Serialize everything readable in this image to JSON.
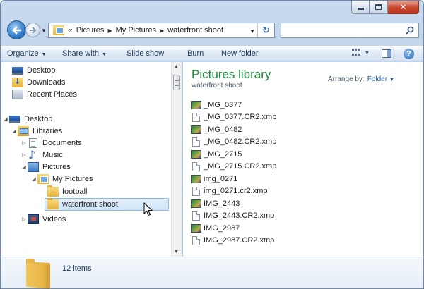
{
  "address": {
    "overflow": "«",
    "crumbs": [
      "Pictures",
      "My Pictures",
      "waterfront shoot"
    ]
  },
  "search": {
    "placeholder": ""
  },
  "toolbar": {
    "organize": "Organize",
    "share_with": "Share with",
    "slide_show": "Slide show",
    "burn": "Burn",
    "new_folder": "New folder"
  },
  "nav_tree": {
    "desktop_fav": "Desktop",
    "downloads": "Downloads",
    "recent_places": "Recent Places",
    "desktop": "Desktop",
    "libraries": "Libraries",
    "documents": "Documents",
    "music": "Music",
    "pictures": "Pictures",
    "my_pictures": "My Pictures",
    "football": "football",
    "waterfront": "waterfront shoot",
    "videos": "Videos"
  },
  "library": {
    "title": "Pictures library",
    "subtitle": "waterfront shoot",
    "arrange_label": "Arrange by:",
    "arrange_value": "Folder"
  },
  "files": [
    {
      "name": "_MG_0377",
      "kind": "image"
    },
    {
      "name": "_MG_0377.CR2.xmp",
      "kind": "doc"
    },
    {
      "name": "_MG_0482",
      "kind": "image"
    },
    {
      "name": "_MG_0482.CR2.xmp",
      "kind": "doc"
    },
    {
      "name": "_MG_2715",
      "kind": "image"
    },
    {
      "name": "_MG_2715.CR2.xmp",
      "kind": "doc"
    },
    {
      "name": "img_0271",
      "kind": "image"
    },
    {
      "name": "img_0271.cr2.xmp",
      "kind": "doc"
    },
    {
      "name": "IMG_2443",
      "kind": "image"
    },
    {
      "name": "IMG_2443.CR2.xmp",
      "kind": "doc"
    },
    {
      "name": "IMG_2987",
      "kind": "image"
    },
    {
      "name": "IMG_2987.CR2.xmp",
      "kind": "doc"
    }
  ],
  "details": {
    "count": "12 items"
  },
  "colors": {
    "library_title": "#1d8a3a",
    "link": "#1f62b5",
    "selection": "#cde4f8"
  }
}
